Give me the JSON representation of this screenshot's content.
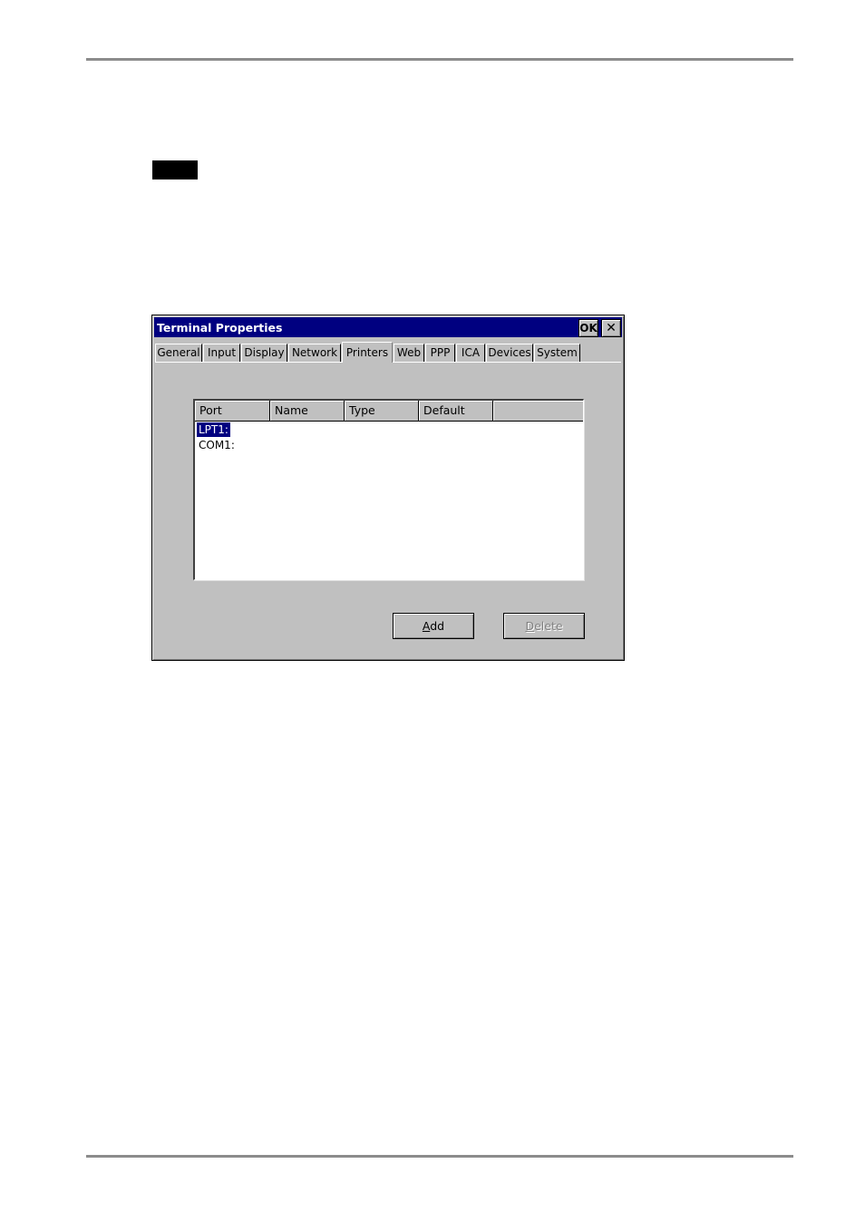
{
  "window": {
    "title": "Terminal Properties",
    "ok_label": "OK",
    "close_label": "✕"
  },
  "tabs": [
    {
      "label": "General"
    },
    {
      "label": "Input"
    },
    {
      "label": "Display"
    },
    {
      "label": "Network"
    },
    {
      "label": "Printers",
      "active": true
    },
    {
      "label": "Web"
    },
    {
      "label": "PPP"
    },
    {
      "label": "ICA"
    },
    {
      "label": "Devices"
    },
    {
      "label": "System"
    }
  ],
  "printers_list": {
    "columns": [
      "Port",
      "Name",
      "Type",
      "Default"
    ],
    "rows": [
      {
        "port": "LPT1:",
        "selected": true
      },
      {
        "port": "COM1:",
        "selected": false
      }
    ]
  },
  "buttons": {
    "add_accel": "A",
    "add_rest": "dd",
    "delete_accel": "D",
    "delete_rest": "elete"
  },
  "colors": {
    "titlebar": "#000080",
    "face": "#c0c0c0",
    "selection": "#000080"
  }
}
